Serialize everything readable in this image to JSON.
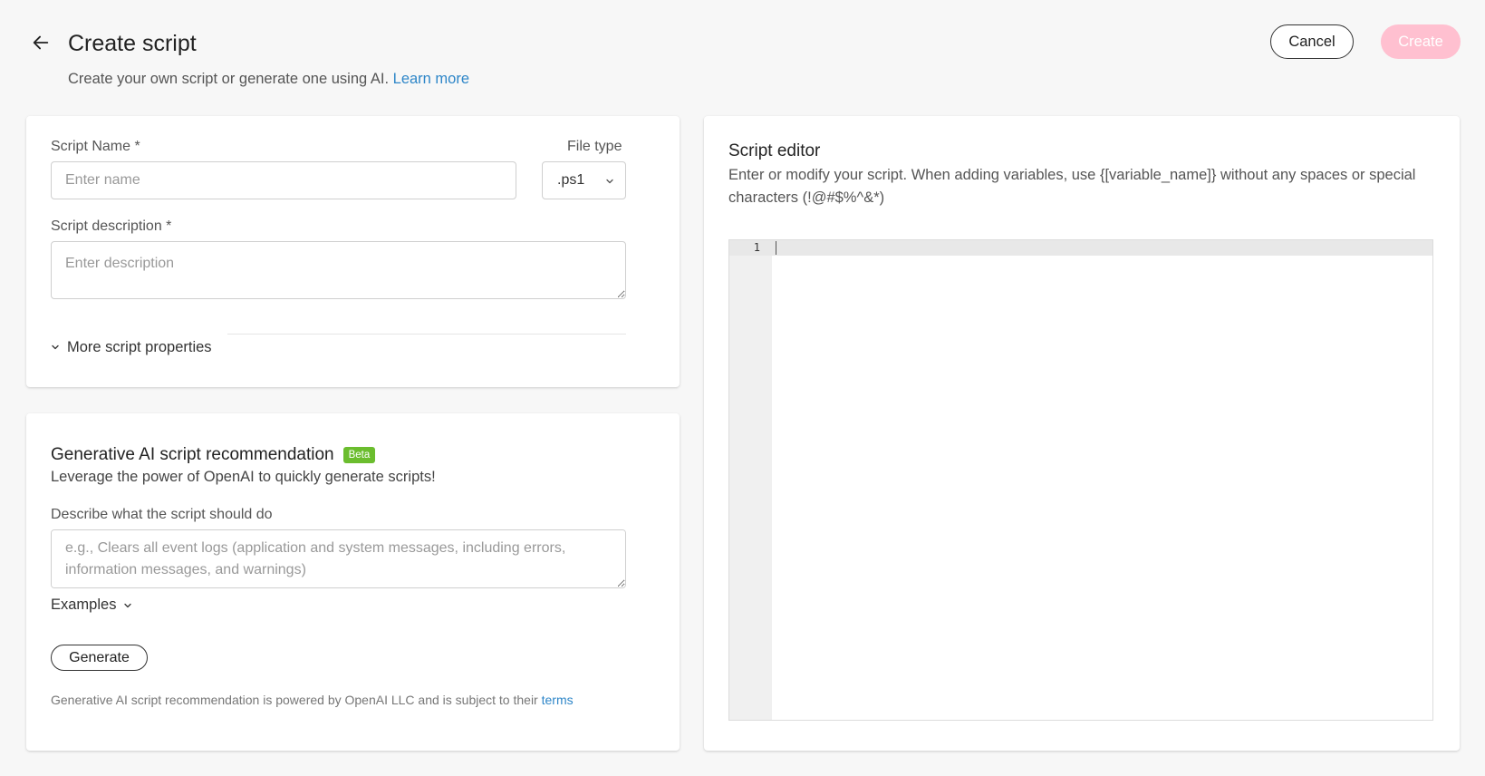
{
  "header": {
    "title": "Create script",
    "subtitle": "Create your own script or generate one using AI.",
    "learn_more": "Learn more",
    "cancel_label": "Cancel",
    "create_label": "Create"
  },
  "props": {
    "name_label": "Script Name *",
    "name_placeholder": "Enter name",
    "file_type_label": "File type",
    "file_type_value": ".ps1",
    "description_label": "Script description *",
    "description_placeholder": "Enter description",
    "more_properties": "More script properties"
  },
  "ai": {
    "title": "Generative AI script recommendation",
    "badge": "Beta",
    "subtitle": "Leverage the power of OpenAI to quickly generate scripts!",
    "prompt_label": "Describe what the script should do",
    "prompt_placeholder": "e.g., Clears all event logs (application and system messages, including errors, information messages, and warnings)",
    "examples_label": "Examples",
    "generate_label": "Generate",
    "footer_text": "Generative AI script recommendation is powered by OpenAI LLC and is subject to their",
    "footer_link": "terms"
  },
  "editor": {
    "title": "Script editor",
    "subtitle": "Enter or modify your script. When adding variables, use {[variable_name]} without any spaces or special characters (!@#$%^&*)",
    "line_numbers": [
      "1"
    ]
  },
  "colors": {
    "link": "#2e86c8",
    "create_disabled": "#ffc0d0",
    "beta_badge": "#6bbd2e"
  }
}
